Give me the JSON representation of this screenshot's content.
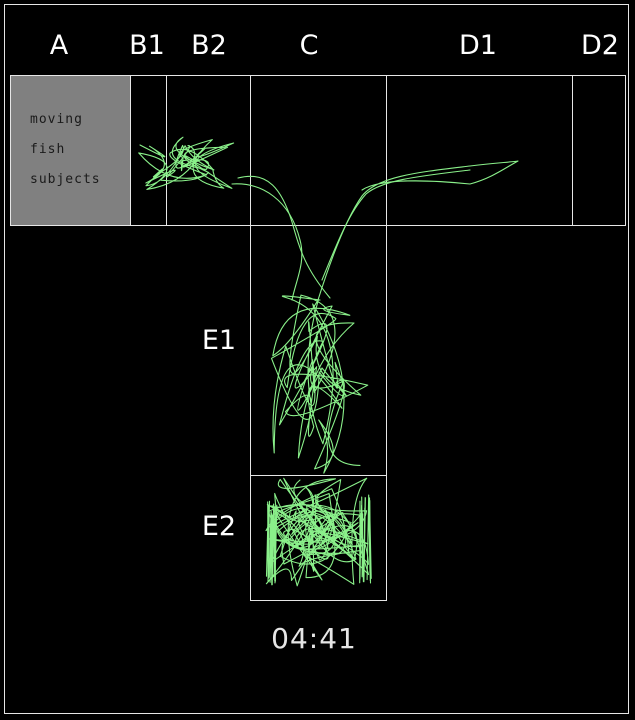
{
  "zones": {
    "A": "A",
    "B1": "B1",
    "B2": "B2",
    "C": "C",
    "D1": "D1",
    "D2": "D2",
    "E1": "E1",
    "E2": "E2"
  },
  "legend": {
    "line1": "moving",
    "line2": "fish",
    "line3": "subjects"
  },
  "timer": "04:41",
  "colors": {
    "background": "#000000",
    "outline": "#e6e6e6",
    "start_arm": "#808080",
    "trace": "#8af08a"
  }
}
